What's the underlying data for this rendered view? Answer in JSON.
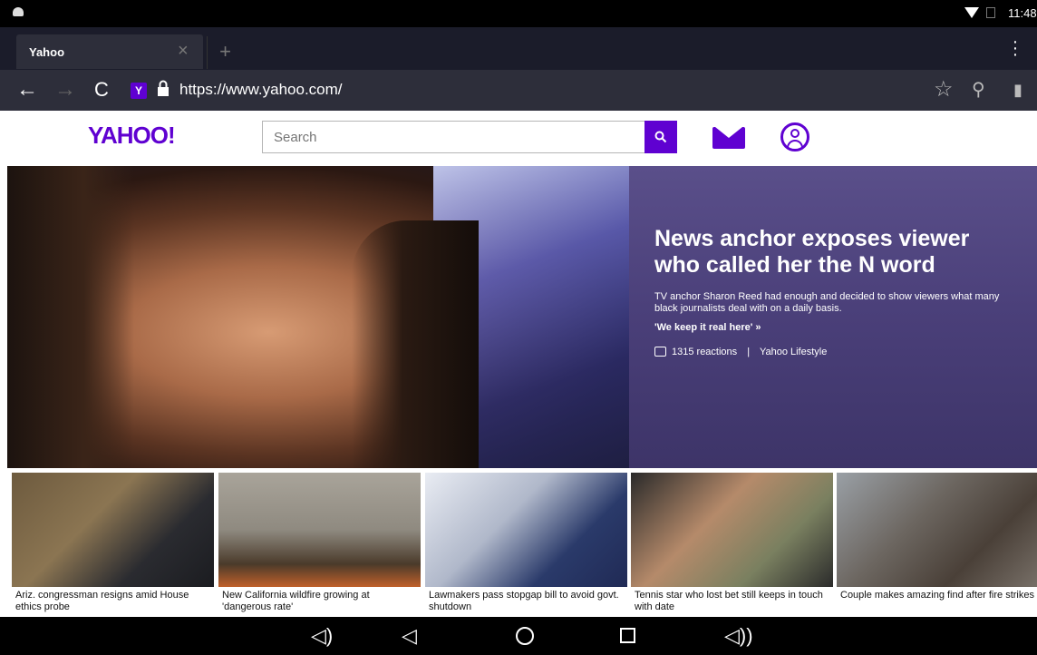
{
  "statusbar": {
    "time": "11:48"
  },
  "browser": {
    "tab_title": "Yahoo",
    "tab_close": "×",
    "new_tab": "+",
    "url": "https://www.yahoo.com/",
    "favicon_letter": "Y",
    "icons": [
      "back-arrow-icon",
      "forward-arrow-icon",
      "reload-icon",
      "lock-icon",
      "star-icon",
      "search-icon",
      "bookmark-icon",
      "overflow-menu-icon"
    ]
  },
  "header": {
    "logo": "YAHOO!",
    "search_placeholder": "Search"
  },
  "hero": {
    "title": "News anchor exposes viewer who called her the N word",
    "description": "TV anchor Sharon Reed had enough and decided to show viewers what many black journalists deal with on a daily basis.",
    "link": "'We keep it real here' »",
    "reactions": "1315 reactions",
    "separator": "|",
    "source": "Yahoo Lifestyle"
  },
  "stories": [
    {
      "caption": "Ariz. congressman resigns amid House ethics probe"
    },
    {
      "caption": "New California wildfire growing at 'dangerous rate'"
    },
    {
      "caption": "Lawmakers pass stopgap bill to avoid govt. shutdown"
    },
    {
      "caption": "Tennis star who lost bet still keeps in touch with date"
    },
    {
      "caption": "Couple makes amazing find after fire strikes"
    }
  ],
  "colors": {
    "brand": "#5f01d1",
    "toolbar": "#2d2e3a",
    "tabbar": "#1b1c2a"
  }
}
